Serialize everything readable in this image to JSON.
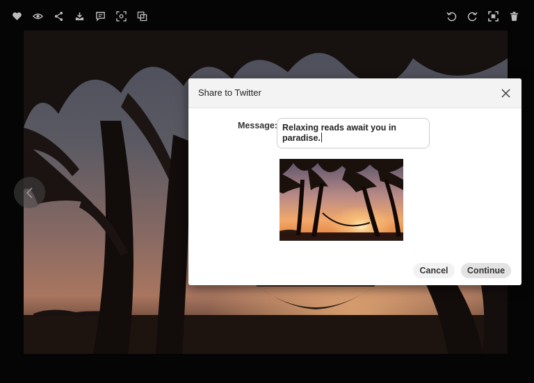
{
  "toolbar": {
    "left_icons": [
      "heart-icon",
      "eye-icon",
      "share-icon",
      "download-icon",
      "comment-icon",
      "scan-icon",
      "copy-icon"
    ],
    "right_icons": [
      "rotate-left-icon",
      "rotate-right-icon",
      "fit-screen-icon",
      "trash-icon"
    ]
  },
  "dialog": {
    "title": "Share to Twitter",
    "message_label": "Message:",
    "message_value": "Relaxing reads await you in paradise.",
    "cancel_label": "Cancel",
    "continue_label": "Continue"
  },
  "colors": {
    "overlay_bg": "#050505",
    "dialog_header_bg": "#f3f3f3",
    "sunset_orange": "#f0a060"
  }
}
